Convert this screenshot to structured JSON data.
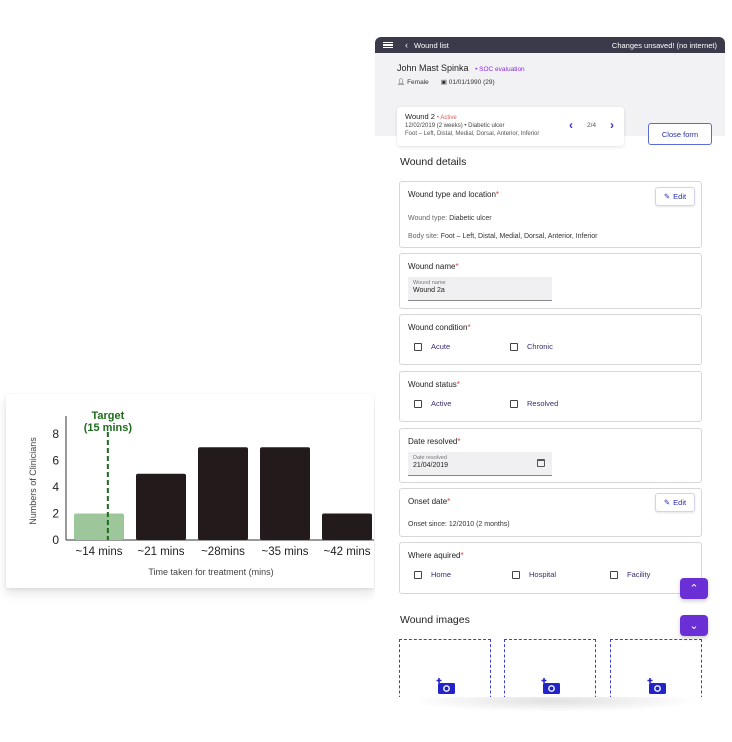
{
  "chart_data": {
    "type": "bar",
    "categories": [
      "~14 mins",
      "~21 mins",
      "~28mins",
      "~35 mins",
      "~42 mins"
    ],
    "values": [
      2,
      5,
      7,
      7,
      2
    ],
    "xlabel": "Time taken for treatment (mins)",
    "ylabel": "Numbers of Clinicians",
    "ylim": [
      0,
      8
    ],
    "yticks": [
      "0",
      "2",
      "4",
      "6",
      "8"
    ],
    "highlight_color": "#9dc79a",
    "bar_color": "#231a1b",
    "target": {
      "label_line1": "Target",
      "label_line2": "(15 mins)",
      "x_value": 15,
      "color": "#1e6b1e"
    },
    "grid": false
  },
  "app": {
    "nav_title": "Wound list",
    "status": "Changes unsaved! (no internet)"
  },
  "patient": {
    "name": "John Mast Spinka",
    "eval_tag": "• SOC evaluation",
    "sex": "Female",
    "dob": "01/01/1990 (29)"
  },
  "wound_card": {
    "title": "Wound 2",
    "status": "• Active",
    "line1": "12/02/2019 (2 weeks) • Diabetic ulcer",
    "line2": "Foot – Left, Distal, Medial, Dorsal, Anterior, Inferior",
    "pager": "2/4"
  },
  "close_form": "Close form",
  "sections": {
    "details_title": "Wound details",
    "images_title": "Wound images"
  },
  "type_location": {
    "label": "Wound type and location",
    "edit": "Edit",
    "type_key": "Wound type:",
    "type_val": "Diabetic ulcer",
    "site_key": "Body site:",
    "site_val": "Foot – Left, Distal, Medial, Dorsal, Anterior, Inferior"
  },
  "wound_name": {
    "label": "Wound name",
    "placeholder": "Wound name",
    "value": "Wound 2a"
  },
  "condition": {
    "label": "Wound condition",
    "options": [
      "Acute",
      "Chronic"
    ]
  },
  "status": {
    "label": "Wound status",
    "options": [
      "Active",
      "Resolved"
    ]
  },
  "date_resolved": {
    "label": "Date resolved",
    "placeholder": "Date resolved",
    "value": "21/04/2019"
  },
  "onset": {
    "label": "Onset date",
    "edit": "Edit",
    "text": "Onset since: 12/2010 (2 months)"
  },
  "acquired": {
    "label": "Where aquired",
    "options": [
      "Home",
      "Hospital",
      "Facility"
    ]
  },
  "required_mark": "*",
  "colors": {
    "accent": "#6b2fd6",
    "link": "#2b2fa8",
    "required": "#e03a3a"
  }
}
